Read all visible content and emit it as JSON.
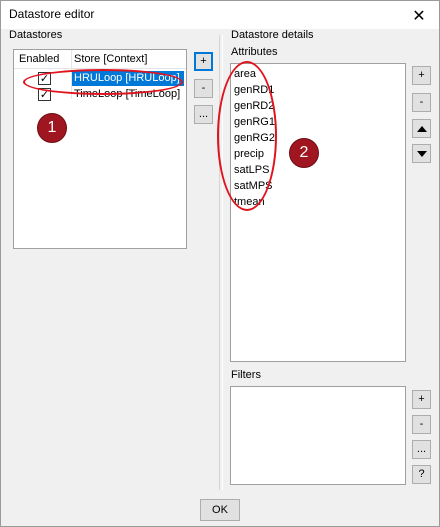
{
  "window": {
    "title": "Datastore editor",
    "close_glyph": "✕"
  },
  "datastores": {
    "label": "Datastores",
    "columns": {
      "enabled": "Enabled",
      "store": "Store [Context]"
    },
    "rows": [
      {
        "enabled": true,
        "store": "HRULoop [HRULoop]",
        "selected": true
      },
      {
        "enabled": true,
        "store": "TimeLoop [TimeLoop]",
        "selected": false
      }
    ],
    "buttons": {
      "add": "+",
      "remove": "-",
      "more": "..."
    }
  },
  "details": {
    "label": "Datastore details",
    "attributes_label": "Attributes",
    "attributes": [
      "area",
      "genRD1",
      "genRD2",
      "genRG1",
      "genRG2",
      "precip",
      "satLPS",
      "satMPS",
      "tmean"
    ],
    "attr_buttons": {
      "add": "+",
      "remove": "-"
    },
    "filters_label": "Filters",
    "filter_buttons": {
      "add": "+",
      "remove": "-",
      "more": "...",
      "help": "?"
    }
  },
  "ok_label": "OK",
  "annotations": {
    "badge1": "1",
    "badge2": "2",
    "color": "#e0141e",
    "badge_color": "#a01620"
  },
  "check_glyph": "✓"
}
